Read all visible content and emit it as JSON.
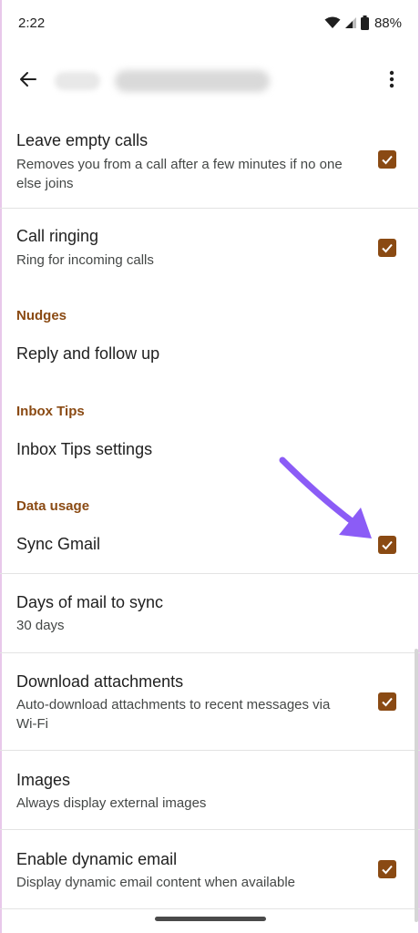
{
  "status_bar": {
    "time": "2:22",
    "battery": "88%"
  },
  "settings": {
    "leave_empty_calls": {
      "title": "Leave empty calls",
      "summary": "Removes you from a call after a few minutes if no one else joins",
      "checked": true
    },
    "call_ringing": {
      "title": "Call ringing",
      "summary": "Ring for incoming calls",
      "checked": true
    },
    "nudges_header": "Nudges",
    "reply_follow_up": {
      "title": "Reply and follow up"
    },
    "inbox_tips_header": "Inbox Tips",
    "inbox_tips_settings": {
      "title": "Inbox Tips settings"
    },
    "data_usage_header": "Data usage",
    "sync_gmail": {
      "title": "Sync Gmail",
      "checked": true
    },
    "days_of_mail": {
      "title": "Days of mail to sync",
      "summary": "30 days"
    },
    "download_attachments": {
      "title": "Download attachments",
      "summary": "Auto-download attachments to recent messages via Wi-Fi",
      "checked": true
    },
    "images": {
      "title": "Images",
      "summary": "Always display external images"
    },
    "dynamic_email": {
      "title": "Enable dynamic email",
      "summary": "Display dynamic email content when available",
      "checked": true
    }
  },
  "colors": {
    "accent": "#8a4a13",
    "annotation_arrow": "#8b5cf6"
  }
}
